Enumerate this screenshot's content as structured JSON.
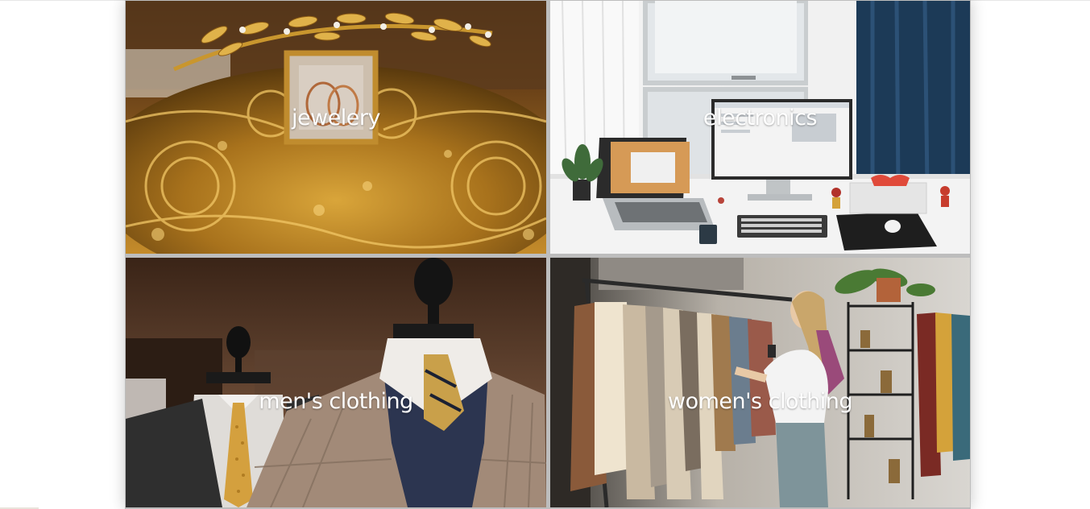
{
  "categories": [
    {
      "label": "jewelery",
      "image": "gold-jewelry-photo"
    },
    {
      "label": "electronics",
      "image": "desk-setup-photo"
    },
    {
      "label": "men's clothing",
      "image": "suit-mannequin-photo"
    },
    {
      "label": "women's clothing",
      "image": "clothing-rack-photo"
    }
  ],
  "colors": {
    "background": "#ffffff",
    "label_text": "#ffffff",
    "gap": "#bdbdbd"
  }
}
